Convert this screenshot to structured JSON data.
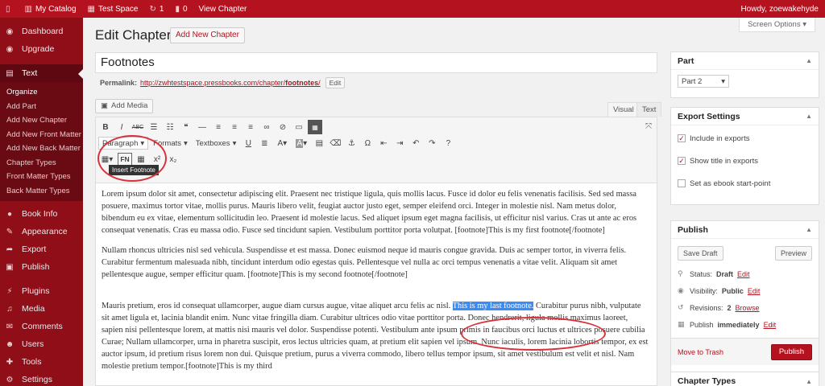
{
  "adminbar": {
    "site_name": "My Catalog",
    "book_name": "Test Space",
    "updates_count": "1",
    "comments_count": "0",
    "view_label": "View Chapter",
    "howdy": "Howdy, zoewakehyde"
  },
  "sidebar": {
    "items": [
      {
        "label": "Dashboard",
        "icon": "dashboard-icon",
        "glyph": "◉"
      },
      {
        "label": "Upgrade",
        "icon": "upgrade-icon",
        "glyph": "◉"
      },
      {
        "label": "Text",
        "icon": "text-icon",
        "glyph": "▤"
      }
    ],
    "text_submenu": [
      "Organize",
      "Add Part",
      "Add New Chapter",
      "Add New Front Matter",
      "Add New Back Matter",
      "Chapter Types",
      "Front Matter Types",
      "Back Matter Types"
    ],
    "items_after": [
      {
        "label": "Book Info",
        "icon": "book-info-icon",
        "glyph": "●"
      },
      {
        "label": "Appearance",
        "icon": "appearance-icon",
        "glyph": "✎"
      },
      {
        "label": "Export",
        "icon": "export-icon",
        "glyph": "➦"
      },
      {
        "label": "Publish",
        "icon": "publish-icon",
        "glyph": "▣"
      },
      {
        "label": "Plugins",
        "icon": "plugins-icon",
        "glyph": "⚡"
      },
      {
        "label": "Media",
        "icon": "media-icon",
        "glyph": "♫"
      },
      {
        "label": "Comments",
        "icon": "comments-icon",
        "glyph": "✉"
      },
      {
        "label": "Users",
        "icon": "users-icon",
        "glyph": "☻"
      },
      {
        "label": "Tools",
        "icon": "tools-icon",
        "glyph": "✚"
      },
      {
        "label": "Settings",
        "icon": "settings-icon",
        "glyph": "⚙"
      }
    ]
  },
  "main": {
    "page_title": "Edit Chapter",
    "add_new_label": "Add New Chapter",
    "screen_options": "Screen Options",
    "title_value": "Footnotes",
    "permalink_label": "Permalink:",
    "permalink_url_prefix": "http://zwhtestspace.pressbooks.com/chapter/",
    "permalink_slug": "footnotes",
    "permalink_url_suffix": "/",
    "permalink_edit": "Edit",
    "add_media": "Add Media",
    "tab_visual": "Visual",
    "tab_text": "Text"
  },
  "toolbar": {
    "paragraph": "Paragraph",
    "formats": "Formats",
    "textboxes": "Textboxes",
    "fn_label": "FN",
    "tooltip": "Insert Footnote"
  },
  "content": {
    "p1": "Lorem ipsum dolor sit amet, consectetur adipiscing elit. Praesent nec tristique ligula, quis mollis lacus. Fusce id dolor eu felis venenatis facilisis. Sed sed massa posuere, maximus tortor vitae, mollis purus. Mauris libero velit, feugiat auctor justo eget, semper eleifend orci. Integer in molestie nisl. Nam metus dolor, bibendum eu ex vitae, elementum sollicitudin leo. Praesent id molestie lacus. Sed aliquet ipsum eget magna facilisis, ut efficitur nisl varius. Cras ut ante ac eros consequat venenatis. Cras eu massa odio. Fusce sed tincidunt sapien. Vestibulum porttitor porta volutpat. [footnote]This is my first footnote[/footnote]",
    "p2": "Nullam rhoncus ultricies nisl sed vehicula. Suspendisse et est massa. Donec euismod neque id mauris congue gravida. Duis ac semper tortor, in viverra felis. Curabitur fermentum malesuada nibh, tincidunt interdum odio egestas quis. Pellentesque vel nulla ac orci tempus venenatis a vitae velit. Aliquam sit amet pellentesque augue, semper efficitur quam. [footnote]This is my second footnote[/footnote]",
    "p3_before": "Mauris pretium, eros id consequat ullamcorper, augue diam cursus augue, vitae aliquet arcu felis ac nisl. ",
    "p3_selected": "This is my last footnote.",
    "p3_after": " Curabitur purus nibh, vulputate sit amet ligula et, lacinia blandit enim. Nunc vitae fringilla diam. Curabitur ultrices odio vitae porttitor porta. Donec hendrerit, ligula mollis maximus laoreet, sapien nisi pellentesque lorem, at mattis nisi mauris vel dolor. Suspendisse potenti. Vestibulum ante ipsum primis in faucibus orci luctus et ultrices posuere cubilia Curae; Nullam ullamcorper, urna in pharetra suscipit, eros lectus ultricies quam, at pretium elit sapien vel ipsum. Nunc iaculis, lorem lacinia lobortis tempor, ex est auctor ipsum, id pretium risus lorem non dui. Quisque pretium, purus a viverra commodo, libero tellus tempor ipsum, sit amet vestibulum est velit et nisl. Nam molestie pretium tempor.[footnote]This is my third"
  },
  "part_box": {
    "title": "Part",
    "selected": "Part 2"
  },
  "export_box": {
    "title": "Export Settings",
    "include": "Include in exports",
    "show_title": "Show title in exports",
    "ebook_start": "Set as ebook start-point"
  },
  "publish_box": {
    "title": "Publish",
    "save_draft": "Save Draft",
    "preview": "Preview",
    "status_label": "Status:",
    "status_value": "Draft",
    "visibility_label": "Visibility:",
    "visibility_value": "Public",
    "revisions_label": "Revisions:",
    "revisions_value": "2",
    "browse": "Browse",
    "publish_label": "Publish",
    "publish_when": "immediately",
    "edit": "Edit",
    "trash": "Move to Trash",
    "publish_button": "Publish"
  },
  "chapter_types_box": {
    "title": "Chapter Types"
  },
  "colors": {
    "brand": "#b4121e",
    "sidebar": "#8f0e18",
    "selection": "#3b8cf5",
    "annotation": "#d9303a"
  }
}
